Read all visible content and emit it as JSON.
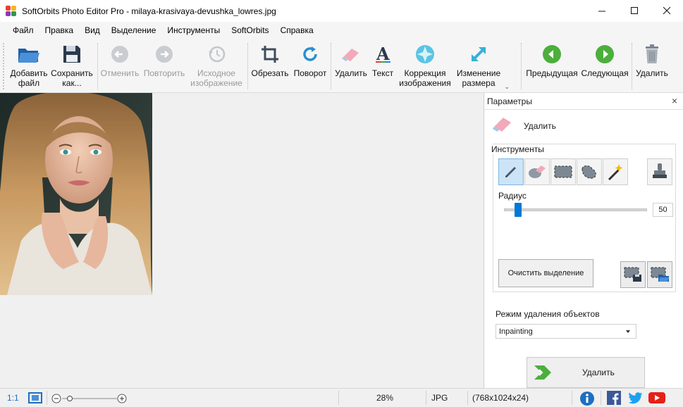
{
  "window": {
    "title": "SoftOrbits Photo Editor Pro - milaya-krasivaya-devushka_lowres.jpg",
    "minimize": "—",
    "maximize": "☐",
    "close": "✕"
  },
  "menu": {
    "items": [
      "Файл",
      "Правка",
      "Вид",
      "Выделение",
      "Инструменты",
      "SoftOrbits",
      "Справка"
    ]
  },
  "toolbar": {
    "add_file": [
      "Добавить",
      "файл"
    ],
    "save_as": [
      "Сохранить",
      "как..."
    ],
    "undo": "Отменить",
    "redo": "Повторить",
    "original": [
      "Исходное",
      "изображение"
    ],
    "crop": "Обрезать",
    "rotate": "Поворот",
    "remove": "Удалить",
    "text": "Текст",
    "correction": [
      "Коррекция",
      "изображения"
    ],
    "resize": [
      "Изменение",
      "размера"
    ],
    "overflow": "⌄",
    "previous": "Предыдущая",
    "next": "Следующая",
    "delete": "Удалить"
  },
  "panel": {
    "title": "Параметры",
    "close": "×",
    "tool_label": "Удалить",
    "group_title": "Инструменты",
    "radius_label": "Радиус",
    "radius_value": "50",
    "radius_fraction": 0.1,
    "clear_selection": "Очистить выделение",
    "mode_label": "Режим удаления объектов",
    "mode_value": "Inpainting",
    "remove_button": "Удалить"
  },
  "status": {
    "ratio": "1:1",
    "zoom": "28%",
    "format": "JPG",
    "dimensions": "(768x1024x24)",
    "zoom_minus": "−",
    "zoom_plus": "+"
  },
  "colors": {
    "green_nav": "#4caf3c",
    "accent_blue": "#0078d7",
    "youtube_red": "#e62117",
    "twitter_blue": "#1da1f2",
    "facebook_blue": "#3b5998"
  }
}
